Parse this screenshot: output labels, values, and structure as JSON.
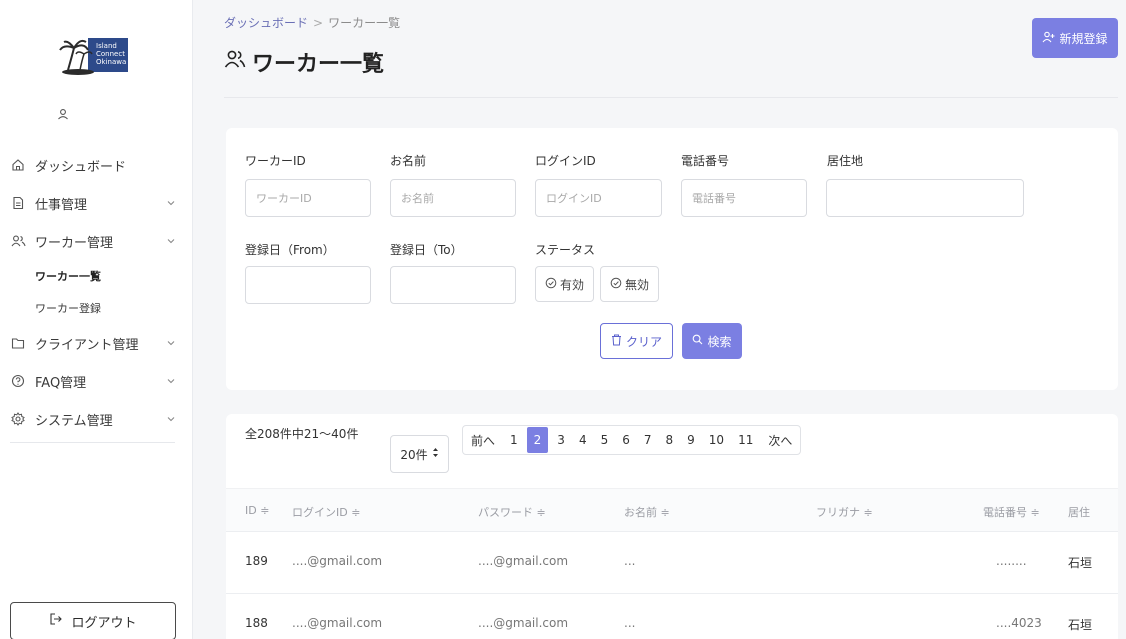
{
  "sidebar": {
    "logo_lines": [
      "Island",
      "Connect",
      "Okinawa"
    ],
    "user_name": "",
    "nav": [
      {
        "label": "ダッシュボード",
        "icon": "home-icon",
        "has_chevron": false
      },
      {
        "label": "仕事管理",
        "icon": "document-icon",
        "has_chevron": true
      },
      {
        "label": "ワーカー管理",
        "icon": "users-icon",
        "has_chevron": true
      },
      {
        "label": "クライアント管理",
        "icon": "folder-icon",
        "has_chevron": true
      },
      {
        "label": "FAQ管理",
        "icon": "help-circle-icon",
        "has_chevron": true
      },
      {
        "label": "システム管理",
        "icon": "gear-icon",
        "has_chevron": true
      }
    ],
    "sub_items": [
      {
        "label": "ワーカー一覧",
        "active": true
      },
      {
        "label": "ワーカー登録",
        "active": false
      }
    ],
    "logout_label": "ログアウト"
  },
  "header": {
    "breadcrumb_parent": "ダッシュボード",
    "breadcrumb_separator": ">",
    "breadcrumb_current": "ワーカー一覧",
    "title": "ワーカー一覧",
    "new_button_label": "新規登録"
  },
  "search": {
    "fields": {
      "worker_id": {
        "label": "ワーカーID",
        "placeholder": "ワーカーID",
        "value": ""
      },
      "name": {
        "label": "お名前",
        "placeholder": "お名前",
        "value": ""
      },
      "login_id": {
        "label": "ログインID",
        "placeholder": "ログインID",
        "value": ""
      },
      "phone": {
        "label": "電話番号",
        "placeholder": "電話番号",
        "value": ""
      },
      "address": {
        "label": "居住地",
        "placeholder": "",
        "value": ""
      },
      "date_from": {
        "label": "登録日（From）",
        "value": ""
      },
      "date_to": {
        "label": "登録日（To）",
        "value": ""
      }
    },
    "status_label": "ステータス",
    "status_options": [
      "有効",
      "無効"
    ],
    "clear_label": "クリア",
    "search_label": "検索"
  },
  "results": {
    "count_text": "全208件中21〜40件",
    "per_page": "20件",
    "pagination": {
      "prev": "前へ",
      "next": "次へ",
      "pages": [
        "1",
        "2",
        "3",
        "4",
        "5",
        "6",
        "7",
        "8",
        "9",
        "10",
        "11"
      ],
      "current": "2"
    },
    "columns": [
      "ID ≑",
      "ログインID ≑",
      "パスワード ≑",
      "お名前 ≑",
      "フリガナ ≑",
      "電話番号 ≑",
      "居住"
    ],
    "rows": [
      {
        "id": "189",
        "login_id": "....@gmail.com",
        "password": "....@gmail.com",
        "name": "...",
        "furigana": "",
        "phone": "........",
        "address": "石垣"
      },
      {
        "id": "188",
        "login_id": "....@gmail.com",
        "password": "....@gmail.com",
        "name": "...",
        "furigana": "",
        "phone": "....4023",
        "address": "石垣"
      }
    ]
  },
  "colors": {
    "accent": "#7b7fe2",
    "breadcrumb_link": "#6a6fb5",
    "logo_bg": "#2d4a8a"
  }
}
